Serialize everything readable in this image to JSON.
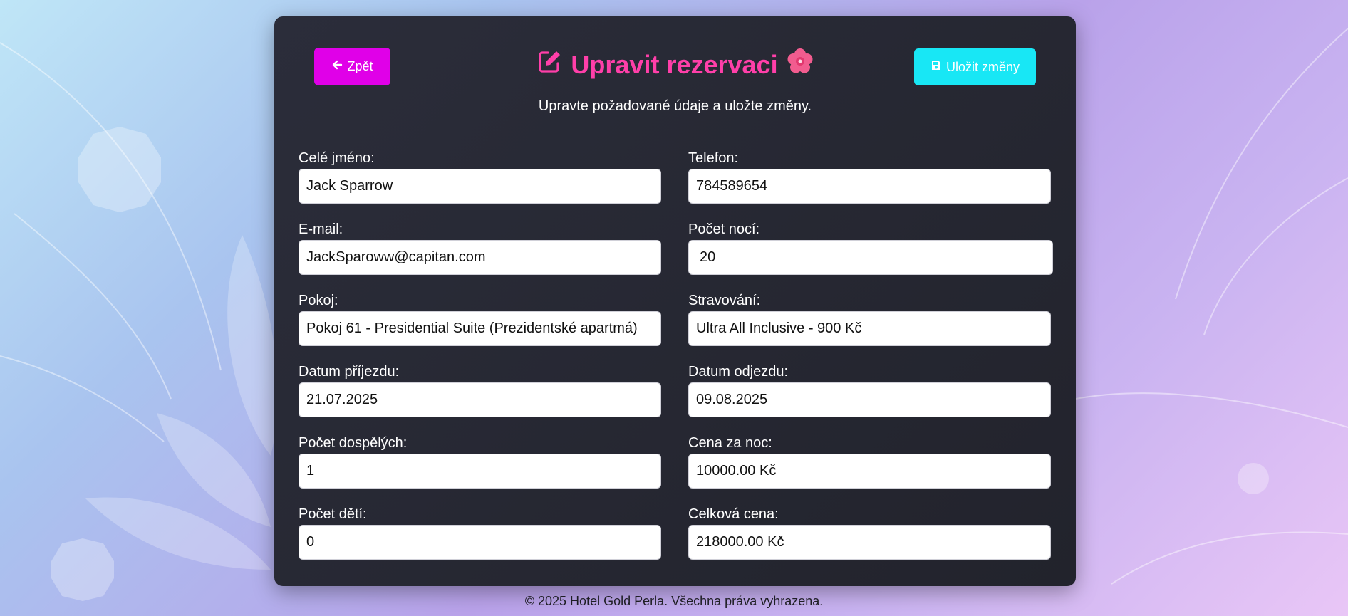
{
  "header": {
    "back_label": "Zpět",
    "title": "Upravit rezervaci",
    "subtitle": "Upravte požadované údaje a uložte změny.",
    "save_label": "Uložit změny"
  },
  "form": {
    "full_name": {
      "label": "Celé jméno:",
      "value": "Jack Sparrow"
    },
    "phone": {
      "label": "Telefon:",
      "value": "784589654"
    },
    "email": {
      "label": "E-mail:",
      "value": "JackSparoww@capitan.com"
    },
    "nights": {
      "label": "Počet nocí:",
      "value": "20"
    },
    "room": {
      "label": "Pokoj:",
      "value": "Pokoj 61 - Presidential Suite (Prezidentské apartmá)"
    },
    "meals": {
      "label": "Stravování:",
      "value": "Ultra All Inclusive - 900 Kč"
    },
    "arrival": {
      "label": "Datum příjezdu:",
      "value": "21.07.2025"
    },
    "departure": {
      "label": "Datum odjezdu:",
      "value": "09.08.2025"
    },
    "adults": {
      "label": "Počet dospělých:",
      "value": "1"
    },
    "price_per_night": {
      "label": "Cena za noc:",
      "value": "10000.00 Kč"
    },
    "children": {
      "label": "Počet dětí:",
      "value": "0"
    },
    "total_price": {
      "label": "Celková cena:",
      "value": "218000.00 Kč"
    }
  },
  "footer": {
    "text": "© 2025 Hotel Gold Perla. Všechna práva vyhrazena."
  },
  "icons": {
    "back": "arrow-left-icon",
    "title": "edit-icon",
    "flower": "hibiscus-icon",
    "save": "floppy-disk-icon"
  },
  "colors": {
    "accent_pink": "#ff3fa9",
    "back_button": "#e000e8",
    "save_button": "#18e7f5",
    "panel": "#262731"
  }
}
